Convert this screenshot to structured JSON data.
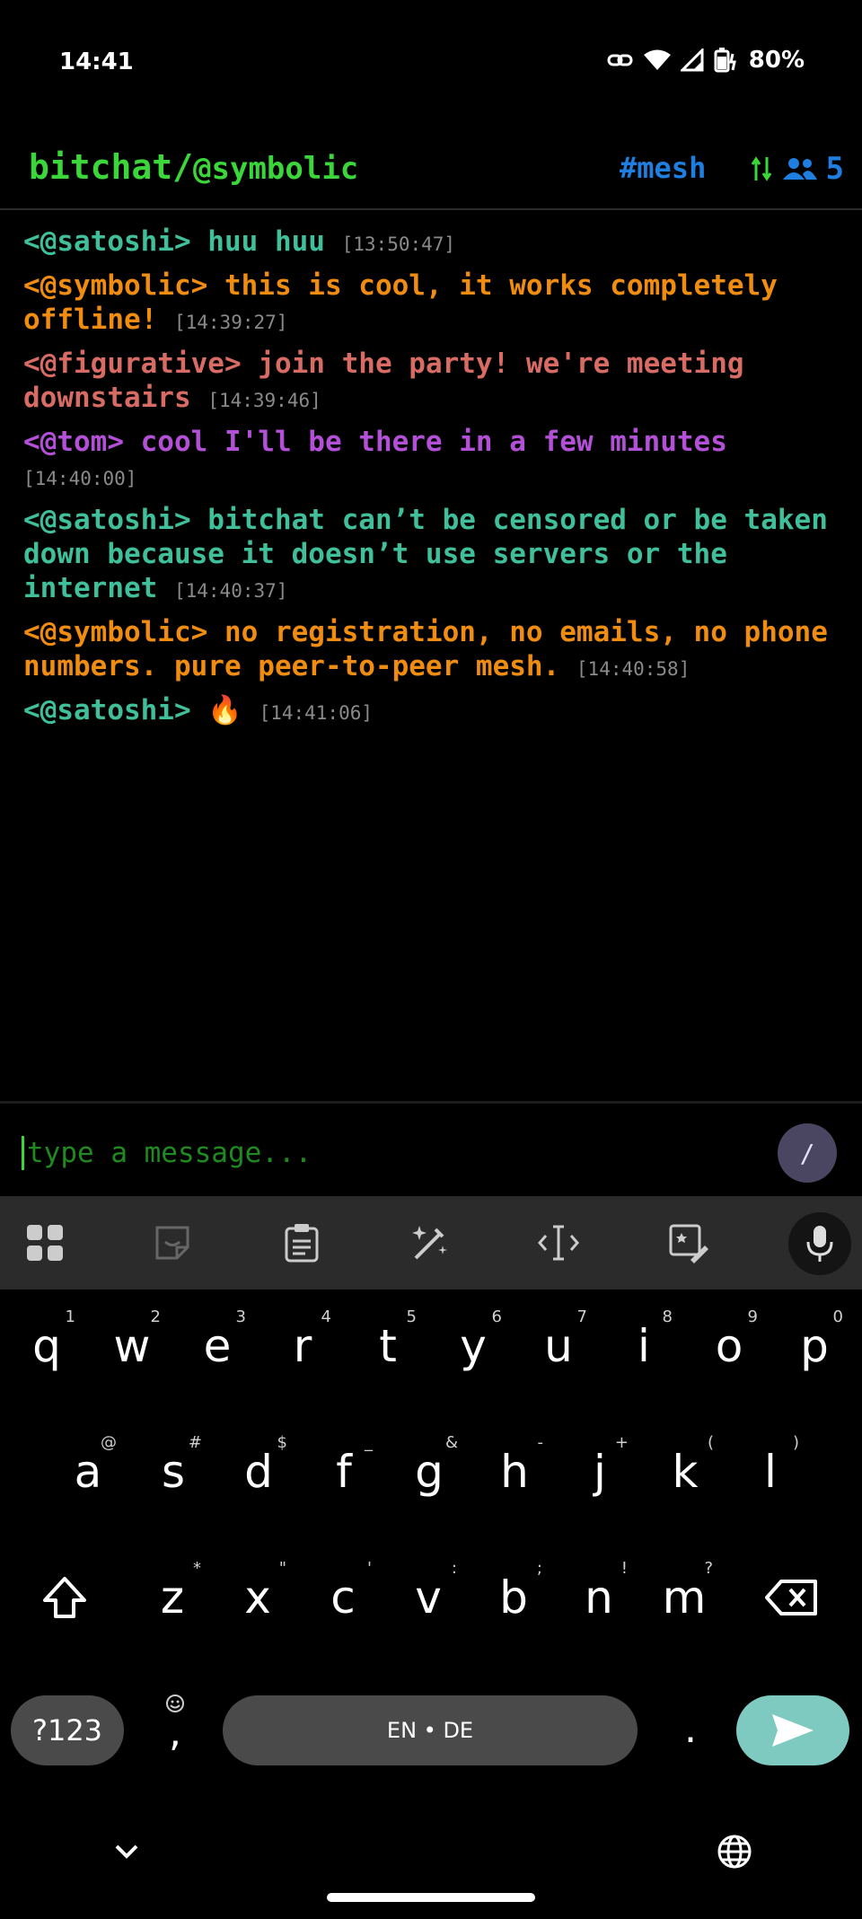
{
  "status": {
    "time": "14:41",
    "battery": "80%"
  },
  "header": {
    "app": "bitchat/",
    "nick": "@symbolic",
    "channel": "#mesh",
    "peer_count": "5"
  },
  "messages": [
    {
      "sender": "<@satoshi>",
      "text": " huu huu ",
      "ts": "[13:50:47]",
      "color": "#3fbf9a"
    },
    {
      "sender": "<@symbolic>",
      "text": " this is cool, it works completely offline! ",
      "ts": "[14:39:27]",
      "color": "#f08c10"
    },
    {
      "sender": "<@figurative>",
      "text": " join the party! we're meeting downstairs ",
      "ts": "[14:39:46]",
      "color": "#d86b64"
    },
    {
      "sender": "<@tom>",
      "text": " cool I'll be there in a few minutes ",
      "ts": "[14:40:00]",
      "color": "#b450d8"
    },
    {
      "sender": "<@satoshi>",
      "text": " bitchat can’t be censored or be taken down because it doesn’t use servers or the internet ",
      "ts": "[14:40:37]",
      "color": "#3fbf9a"
    },
    {
      "sender": "<@symbolic>",
      "text": " no registration, no emails, no phone numbers. pure peer-to-peer mesh. ",
      "ts": "[14:40:58]",
      "color": "#f08c10"
    },
    {
      "sender": "<@satoshi>",
      "text": " 🔥 ",
      "ts": "[14:41:06]",
      "color": "#3fbf9a"
    }
  ],
  "input": {
    "placeholder": "type a message...",
    "command_label": "/"
  },
  "keyboard": {
    "row1": [
      [
        "q",
        "1"
      ],
      [
        "w",
        "2"
      ],
      [
        "e",
        "3"
      ],
      [
        "r",
        "4"
      ],
      [
        "t",
        "5"
      ],
      [
        "y",
        "6"
      ],
      [
        "u",
        "7"
      ],
      [
        "i",
        "8"
      ],
      [
        "o",
        "9"
      ],
      [
        "p",
        "0"
      ]
    ],
    "row2": [
      [
        "a",
        "@"
      ],
      [
        "s",
        "#"
      ],
      [
        "d",
        "$"
      ],
      [
        "f",
        "_"
      ],
      [
        "g",
        "&"
      ],
      [
        "h",
        "-"
      ],
      [
        "j",
        "+"
      ],
      [
        "k",
        "("
      ],
      [
        "l",
        ")"
      ]
    ],
    "row3": [
      [
        "z",
        "*"
      ],
      [
        "x",
        "\""
      ],
      [
        "c",
        "'"
      ],
      [
        "v",
        ":"
      ],
      [
        "b",
        ";"
      ],
      [
        "n",
        "!"
      ],
      [
        "m",
        "?"
      ]
    ],
    "symbols_label": "?123",
    "space_label": "EN • DE",
    "comma": ",",
    "period": "."
  },
  "colors": {
    "accent_green": "#3ad63a",
    "accent_blue": "#1e7fe0"
  }
}
